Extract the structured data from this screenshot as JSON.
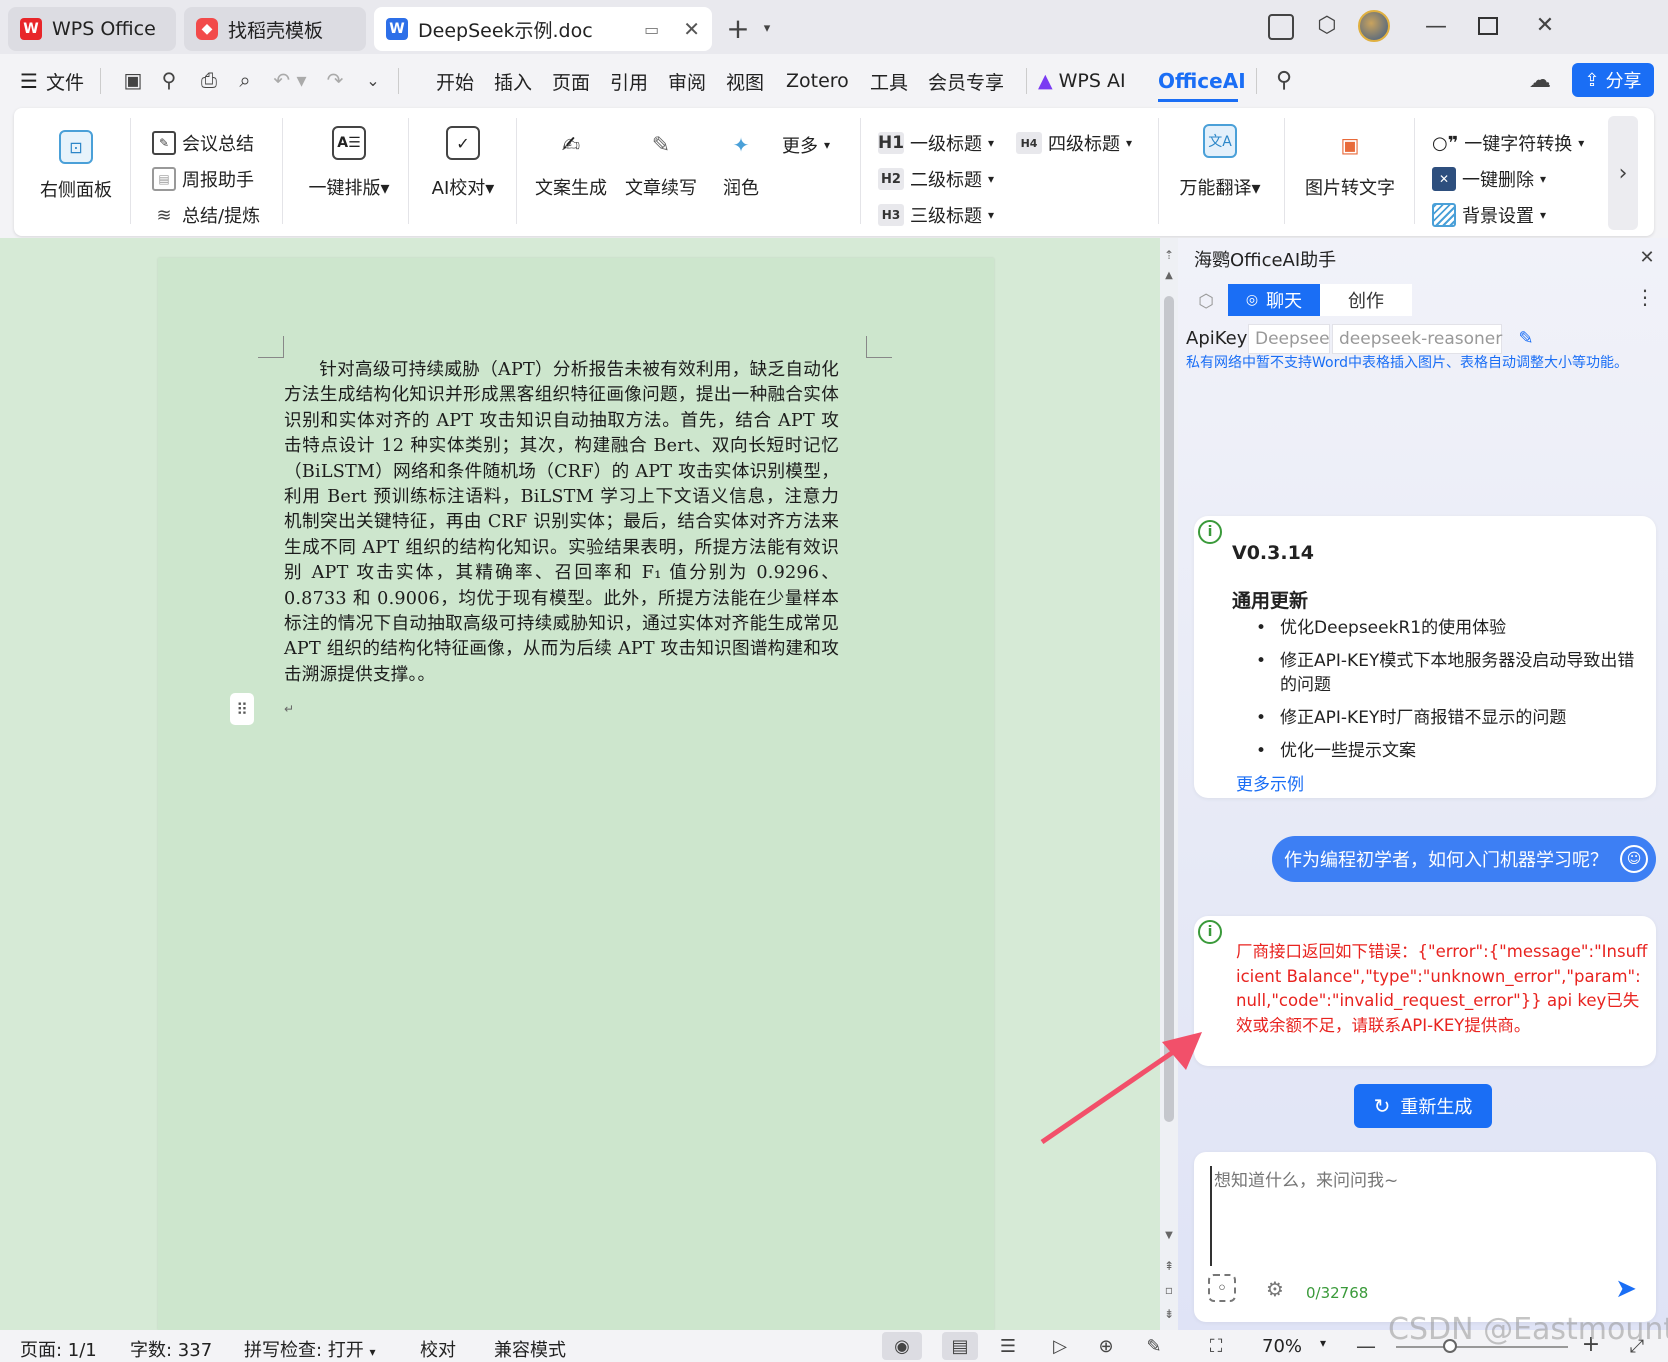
{
  "tabs": [
    {
      "label": "WPS Office"
    },
    {
      "label": "找稻壳模板"
    },
    {
      "label": "DeepSeek示例.doc"
    }
  ],
  "menu": {
    "file": "文件",
    "items": [
      "开始",
      "插入",
      "页面",
      "引用",
      "审阅",
      "视图",
      "Zotero",
      "工具",
      "会员专享"
    ],
    "wps_ai": "WPS AI",
    "officeai": "OfficeAI",
    "share": "分享"
  },
  "ribbon": {
    "right_panel": "右侧面板",
    "meeting_summary": "会议总结",
    "weekly_helper": "周报助手",
    "summarize": "总结/提炼",
    "one_click_layout": "一键排版",
    "ai_proofread": "AI校对",
    "copy_gen": "文案生成",
    "continue_write": "文章续写",
    "polish": "润色",
    "more": "更多",
    "h1": "一级标题",
    "h2": "二级标题",
    "h3": "三级标题",
    "h4": "四级标题",
    "translate": "万能翻译",
    "img_to_text": "图片转文字",
    "char_convert": "一键字符转换",
    "one_click_delete": "一键删除",
    "bg_setting": "背景设置"
  },
  "document": {
    "paragraph": "针对高级可持续威胁（APT）分析报告未被有效利用，缺乏自动化方法生成结构化知识并形成黑客组织特征画像问题，提出一种融合实体识别和实体对齐的 APT 攻击知识自动抽取方法。首先，结合 APT 攻击特点设计 12 种实体类别；其次，构建融合 Bert、双向长短时记忆（BiLSTM）网络和条件随机场（CRF）的 APT 攻击实体识别模型，利用 Bert 预训练标注语料，BiLSTM 学习上下文语义信息，注意力机制突出关键特征，再由 CRF 识别实体；最后，结合实体对齐方法来生成不同 APT 组织的结构化知识。实验结果表明，所提方法能有效识别 APT 攻击实体，其精确率、召回率和 F₁ 值分别为 0.9296、0.8733 和 0.9006，均优于现有模型。此外，所提方法能在少量样本标注的情况下自动抽取高级可持续威胁知识，通过实体对齐能生成常见 APT 组织的结构化特征画像，从而为后续 APT 攻击知识图谱构建和攻击溯源提供支撑。。"
  },
  "panel": {
    "title": "海鹦OfficeAI助手",
    "tab_chat": "聊天",
    "tab_create": "创作",
    "apikey_label": "ApiKey",
    "provider": "Deepseel",
    "model": "deepseek-reasoner",
    "notice": "私有网络中暂不支持Word中表格插入图片、表格自动调整大小等功能。",
    "update": {
      "version": "V0.3.14",
      "heading": "通用更新",
      "items": [
        "优化DeepseekR1的使用体验",
        "修正API-KEY模式下本地服务器没启动导致出错的问题",
        "修正API-KEY时厂商报错不显示的问题",
        "优化一些提示文案"
      ],
      "more": "更多示例"
    },
    "user_question": "作为编程初学者，如何入门机器学习呢？",
    "error_message": "厂商接口返回如下错误：{\"error\":{\"message\":\"Insufficient Balance\",\"type\":\"unknown_error\",\"param\":null,\"code\":\"invalid_request_error\"}} api key已失效或余额不足，请联系API-KEY提供商。",
    "regenerate": "重新生成",
    "input_placeholder": "想知道什么，来问问我~",
    "char_count": "0/32768"
  },
  "status": {
    "page": "页面: 1/1",
    "words": "字数: 337",
    "spell": "拼写检查: 打开",
    "proof": "校对",
    "compat": "兼容模式",
    "zoom": "70%",
    "zoom_level": 0.7
  },
  "watermark": "CSDN @Eastmount",
  "colors": {
    "accent": "#1a6ef5",
    "error": "#e8231f",
    "doc_bg": "#cde6cd"
  }
}
